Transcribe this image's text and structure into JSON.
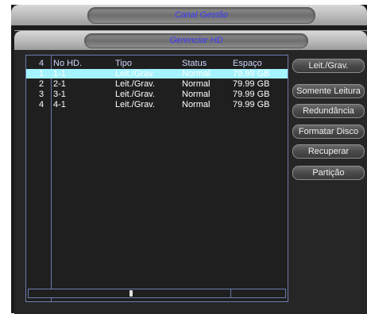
{
  "outer_window": {
    "title": "Canal Gestão"
  },
  "inner_window": {
    "title": "Gerenciar HD"
  },
  "disk_table": {
    "header": {
      "count": "4",
      "no_hd": "No HD.",
      "tipo": "Tipo",
      "status": "Status",
      "espaco": "Espaço"
    },
    "rows": [
      {
        "idx": "1",
        "no_hd": "1-1",
        "tipo": "Leit./Grav.",
        "status": "Normal",
        "espaco": "79.99 GB",
        "selected": true
      },
      {
        "idx": "2",
        "no_hd": "2-1",
        "tipo": "Leit./Grav.",
        "status": "Normal",
        "espaco": "79.99 GB",
        "selected": false
      },
      {
        "idx": "3",
        "no_hd": "3-1",
        "tipo": "Leit./Grav.",
        "status": "Normal",
        "espaco": "79.99 GB",
        "selected": false
      },
      {
        "idx": "4",
        "no_hd": "4-1",
        "tipo": "Leit./Grav.",
        "status": "Normal",
        "espaco": "79.99 GB",
        "selected": false
      }
    ]
  },
  "actions": {
    "read_write": "Leit./Grav.",
    "read_only": "Somente Leitura",
    "redundancy": "Redundância",
    "format": "Formatar Disco",
    "recover": "Recuperar",
    "partition": "Partição"
  },
  "colors": {
    "title_text": "#3b3bff",
    "selection": "#a4f3ff",
    "list_border": "#6e7cae"
  }
}
